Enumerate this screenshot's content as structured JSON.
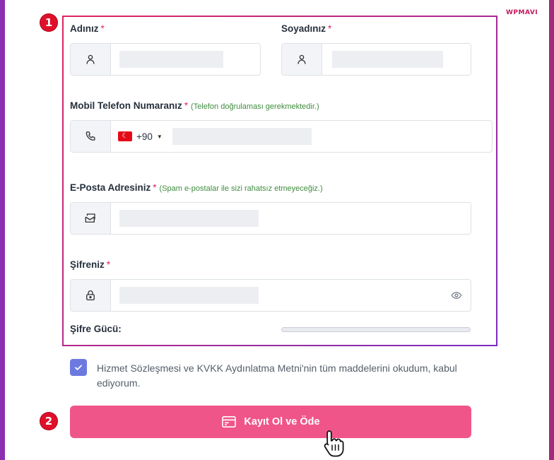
{
  "brand": "WPMAVI",
  "markers": {
    "one": "1",
    "two": "2"
  },
  "form": {
    "first_name": {
      "label": "Adınız",
      "required": "*",
      "value": ""
    },
    "last_name": {
      "label": "Soyadınız",
      "required": "*",
      "value": ""
    },
    "phone": {
      "label": "Mobil Telefon Numaranız",
      "required": "*",
      "hint": "(Telefon doğrulaması gerekmektedir.)",
      "country_code": "+90",
      "value": ""
    },
    "email": {
      "label": "E-Posta Adresiniz",
      "required": "*",
      "hint": "(Spam e-postalar ile sizi rahatsız etmeyeceğiz.)",
      "value": ""
    },
    "password": {
      "label": "Şifreniz",
      "required": "*",
      "value": ""
    },
    "strength": {
      "label": "Şifre Gücü:",
      "level": 0
    },
    "consent": {
      "checked": true,
      "text": "Hizmet Sözleşmesi ve KVKK Aydınlatma Metni'nin tüm maddelerini okudum, kabul ediyorum."
    },
    "submit_label": "Kayıt Ol ve Öde"
  },
  "icons": {
    "name": "user-icon",
    "phone": "phone-icon",
    "email": "mail-icon",
    "password": "lock-icon",
    "reveal": "eye-icon",
    "submit": "payment-card-icon"
  },
  "colors": {
    "accent": "#f0558a",
    "marker": "#e0102a",
    "required": "#e0245e",
    "hint": "#3f8c3f",
    "checkbox": "#6c7ae0"
  }
}
